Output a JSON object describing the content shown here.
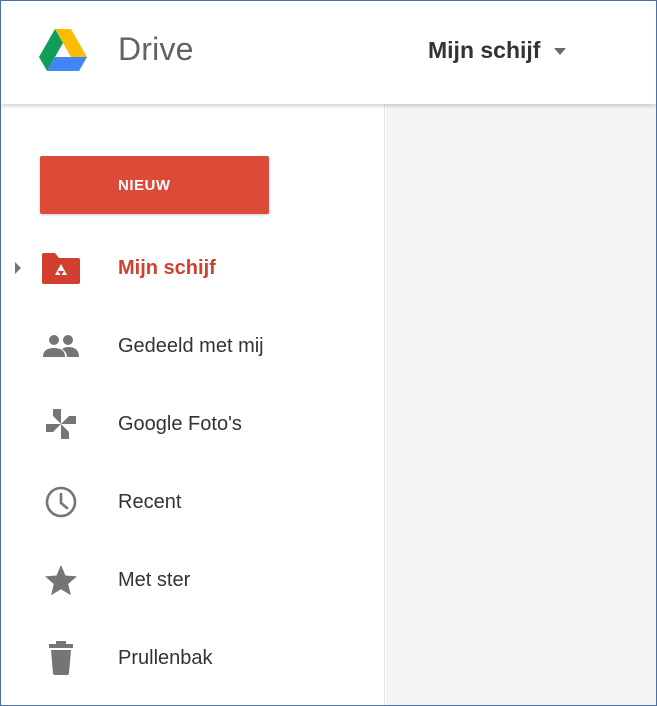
{
  "header": {
    "app_title": "Drive",
    "location_label": "Mijn schijf"
  },
  "sidebar": {
    "new_button_label": "NIEUW",
    "items": [
      {
        "label": "Mijn schijf",
        "icon": "my-drive-folder-icon",
        "active": true
      },
      {
        "label": "Gedeeld met mij",
        "icon": "people-icon",
        "active": false
      },
      {
        "label": "Google Foto's",
        "icon": "google-photos-icon",
        "active": false
      },
      {
        "label": "Recent",
        "icon": "clock-icon",
        "active": false
      },
      {
        "label": "Met ster",
        "icon": "star-icon",
        "active": false
      },
      {
        "label": "Prullenbak",
        "icon": "trash-icon",
        "active": false
      }
    ]
  },
  "colors": {
    "accent_red": "#dc4a38",
    "active_text": "#d23f31",
    "icon_gray": "#757575",
    "main_background": "#f5f5f5"
  }
}
